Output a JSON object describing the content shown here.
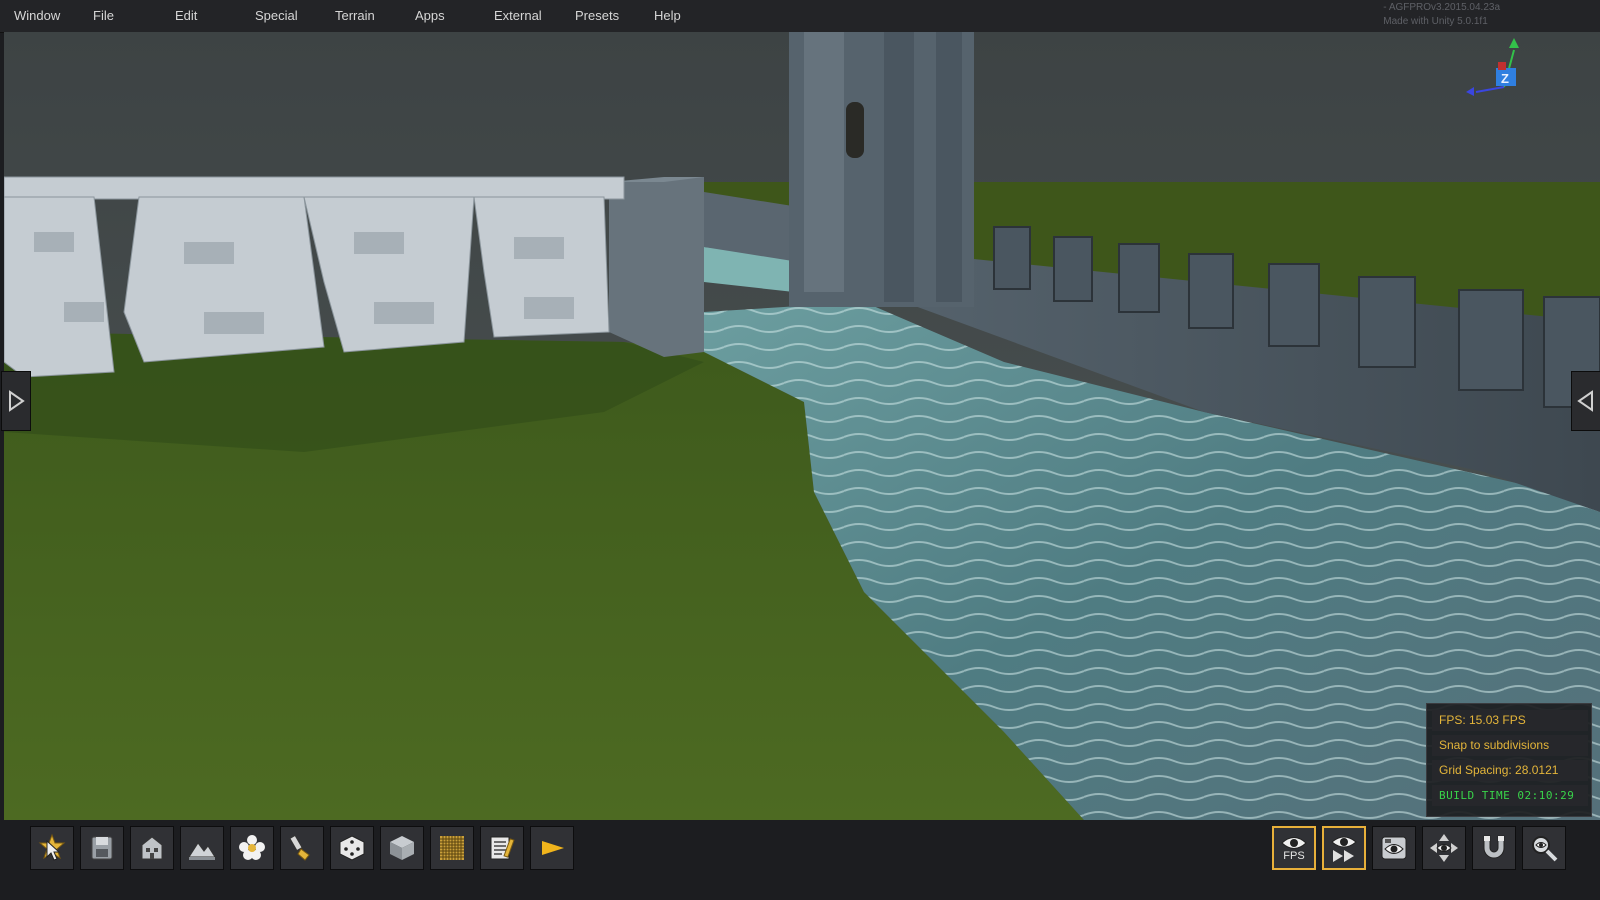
{
  "menubar": {
    "items": [
      "Window",
      "File",
      "Edit",
      "Special",
      "Terrain",
      "Apps",
      "External",
      "Presets",
      "Help"
    ],
    "version_line1": "- AGFPROv3.2015.04.23a",
    "version_line2": "Made with Unity 5.0.1f1"
  },
  "viewport": {
    "gizmo_axis_label": "Z",
    "left_panel_icon": "expand-right-arrow-icon",
    "right_panel_icon": "expand-left-arrow-icon"
  },
  "info_panel": {
    "fps": "FPS: 15.03 FPS",
    "snap": "Snap to subdivisions",
    "grid_spacing": "Grid Spacing: 28.0121",
    "build_time": "BUILD TIME 02:10:29"
  },
  "toolbar_left": [
    {
      "name": "select-tool-icon"
    },
    {
      "name": "save-icon"
    },
    {
      "name": "buildings-icon"
    },
    {
      "name": "terrain-icon"
    },
    {
      "name": "flower-icon"
    },
    {
      "name": "paint-brush-icon"
    },
    {
      "name": "dice-icon"
    },
    {
      "name": "cube-icon"
    },
    {
      "name": "grid-icon"
    },
    {
      "name": "notes-icon"
    },
    {
      "name": "play-icon"
    }
  ],
  "toolbar_right": {
    "fps_label": "FPS",
    "items": [
      {
        "name": "fps-camera-icon",
        "active": true
      },
      {
        "name": "fly-camera-icon",
        "active": true
      },
      {
        "name": "screenshot-camera-icon",
        "active": false
      },
      {
        "name": "move-camera-icon",
        "active": false
      },
      {
        "name": "snap-magnet-icon",
        "active": false
      },
      {
        "name": "zoom-icon",
        "active": false
      }
    ]
  },
  "colors": {
    "accent": "#e8b03a",
    "build_time_green": "#39d34a",
    "menu_text": "#d6d6d6"
  }
}
